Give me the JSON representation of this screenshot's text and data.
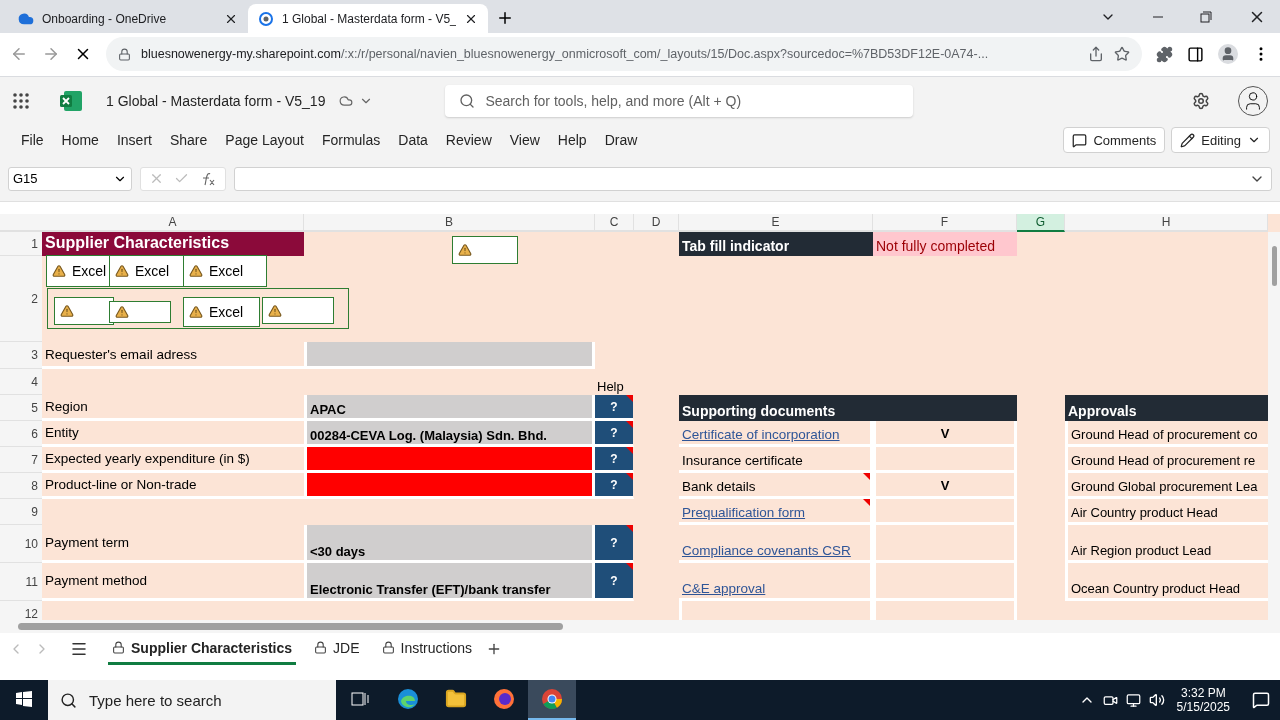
{
  "browser": {
    "tabs": [
      {
        "title": "Onboarding - OneDrive",
        "selected": false
      },
      {
        "title": "1 Global - Masterdata form - V5_",
        "selected": true
      }
    ],
    "url": {
      "host": "bluesnowenergy-my.sharepoint.com",
      "path": "/:x:/r/personal/navien_bluesnowenergy_onmicrosoft_com/_layouts/15/Doc.aspx?sourcedoc=%7BD53DF12E-0A74-..."
    }
  },
  "app": {
    "document_title": "1 Global - Masterdata form - V5_19",
    "search": {
      "placeholder": "Search for tools, help, and more (Alt + Q)"
    },
    "menu": [
      "File",
      "Home",
      "Insert",
      "Share",
      "Page Layout",
      "Formulas",
      "Data",
      "Review",
      "View",
      "Help",
      "Draw"
    ],
    "buttons": [
      {
        "kind": "comments",
        "label": "Comments"
      },
      {
        "kind": "editing",
        "label": "Editing"
      }
    ]
  },
  "formula_bar": {
    "name_box": "G15"
  },
  "sheet": {
    "columns": [
      {
        "label": "A",
        "selected": false
      },
      {
        "label": "B",
        "selected": false
      },
      {
        "label": "C",
        "selected": false
      },
      {
        "label": "D",
        "selected": false
      },
      {
        "label": "E",
        "selected": false
      },
      {
        "label": "F",
        "selected": false
      },
      {
        "label": "G",
        "selected": true
      },
      {
        "label": "H",
        "selected": false
      }
    ],
    "row_numbers": [
      "1",
      "2",
      "3",
      "4",
      "5",
      "6",
      "7",
      "8",
      "9",
      "10",
      "11",
      "12"
    ],
    "title": "Supplier Characteristics",
    "fill_indicator": {
      "label": "Tab fill indicator",
      "value": "Not fully completed"
    },
    "help_label": "Help",
    "fields": [
      {
        "label": "Requester's email adress",
        "missing": false
      },
      {
        "label": "Region",
        "value": "APAC",
        "missing": false,
        "help": "?",
        "has_comment": true
      },
      {
        "label": "Entity",
        "value": "00284-CEVA Log. (Malaysia) Sdn. Bhd.",
        "missing": false,
        "help": "?",
        "has_comment": true
      },
      {
        "label": "Expected yearly expenditure (in $)",
        "missing": true,
        "help": "?",
        "has_comment": true
      },
      {
        "label": "Product-line or Non-trade",
        "missing": true,
        "help": "?",
        "has_comment": true
      },
      {
        "label": "Payment term",
        "value": "<30 days",
        "missing": false,
        "help": "?",
        "has_comment": true
      },
      {
        "label": "Payment method",
        "value": "Electronic Transfer (EFT)/bank transfer",
        "missing": false,
        "help": "?",
        "has_comment": true
      }
    ],
    "supporting_documents": {
      "title": "Supporting documents",
      "items": [
        {
          "name": "Certificate of incorporation",
          "link": true,
          "has_comment": false,
          "received": "V"
        },
        {
          "name": "Insurance certificate",
          "link": false,
          "has_comment": false
        },
        {
          "name": "Bank details",
          "link": false,
          "has_comment": true,
          "received": "V"
        },
        {
          "name": "Prequalification form ",
          "link": true,
          "has_comment": true
        },
        {
          "name": "Compliance covenants CSR",
          "link": true,
          "has_comment": false
        },
        {
          "name": "C&E approval",
          "link": true,
          "has_comment": false
        }
      ]
    },
    "approvals": {
      "title": "Approvals",
      "items": [
        "Ground Head of procurement co",
        "Ground Head of procurement re",
        "Ground Global procurement Lea",
        "Air Country product Head",
        "Air Region product Lead",
        "Ocean Country product Head"
      ]
    },
    "image_placeholders": [
      {
        "kind": "blank"
      },
      {
        "kind": "labeled",
        "label": "Excel"
      },
      {
        "kind": "labeled",
        "label": "Excel"
      },
      {
        "kind": "labeled",
        "label": "Excel"
      },
      {
        "kind": "frame"
      },
      {
        "kind": "blank"
      },
      {
        "kind": "blank"
      },
      {
        "kind": "labeled",
        "label": "Excel"
      },
      {
        "kind": "blank"
      }
    ]
  },
  "sheet_tabs": [
    {
      "label": "Supplier Characteristics",
      "selected": true
    },
    {
      "label": "JDE",
      "selected": false
    },
    {
      "label": "Instructions",
      "selected": false
    }
  ],
  "taskbar": {
    "search_placeholder": "Type here to search",
    "time": "3:32 PM",
    "date": "5/15/2025"
  }
}
